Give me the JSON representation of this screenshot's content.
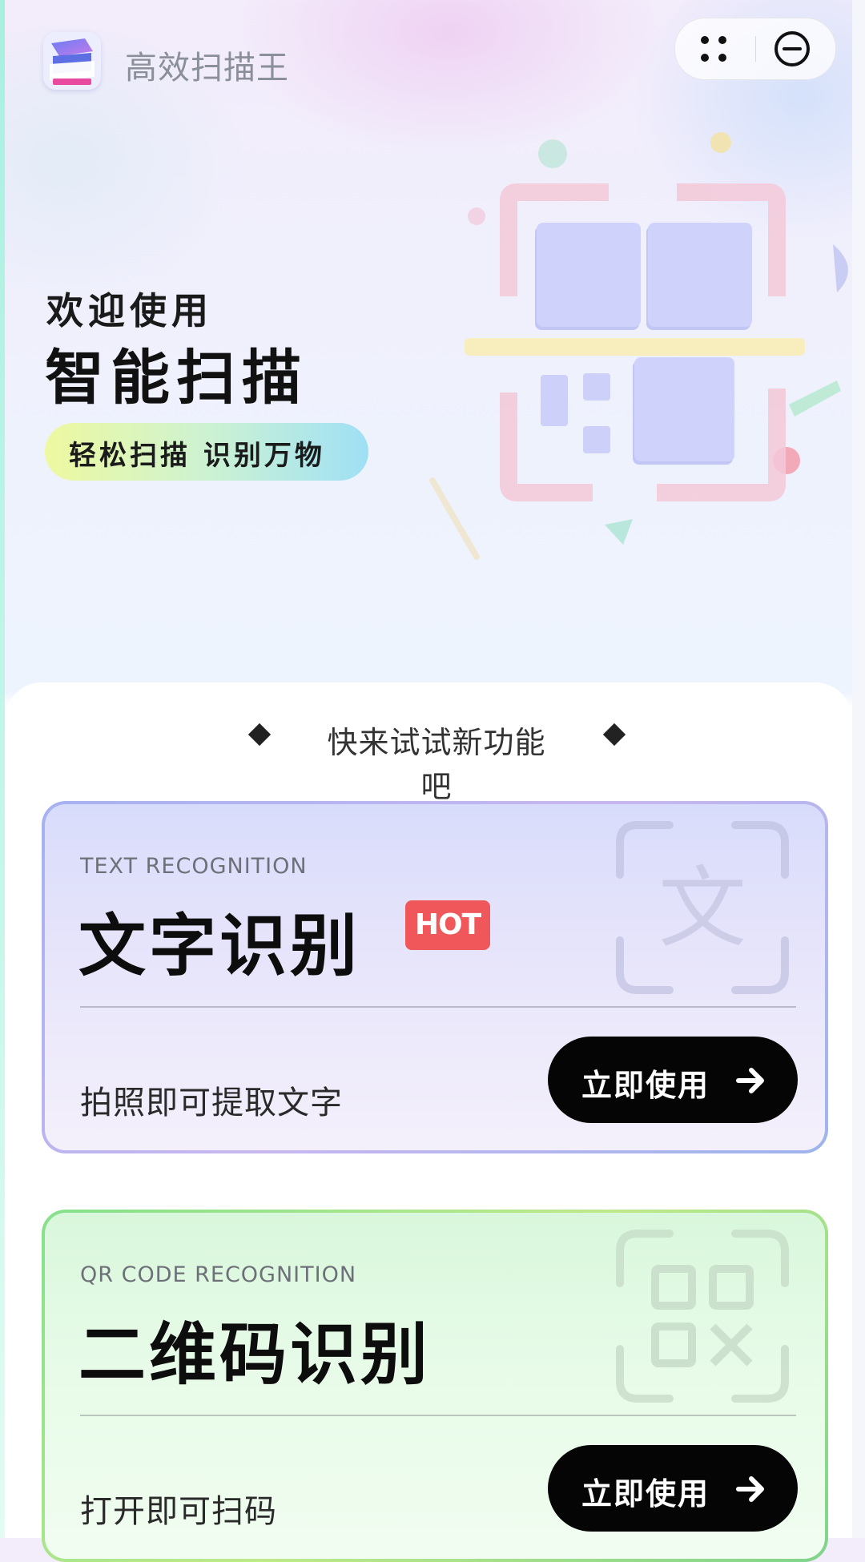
{
  "app": {
    "title": "高效扫描王",
    "logo_icon": "stacked-papers-icon"
  },
  "capsule": {
    "menu_icon": "more-dots-icon",
    "close_icon": "minus-circle-icon"
  },
  "hero": {
    "welcome": "欢迎使用",
    "title": "智能扫描",
    "tagline": "轻松扫描 识别万物",
    "illustration": "qr-scan-illustration"
  },
  "section": {
    "title": "快来试试新功能吧"
  },
  "cards": [
    {
      "subtitle": "TEXT RECOGNITION",
      "title": "文字识别",
      "badge": "HOT",
      "description": "拍照即可提取文字",
      "button_label": "立即使用",
      "watermark_icon": "text-scan-icon",
      "watermark_glyph": "文"
    },
    {
      "subtitle": "QR CODE RECOGNITION",
      "title": "二维码识别",
      "description": "打开即可扫码",
      "button_label": "立即使用",
      "watermark_icon": "qr-scan-icon"
    }
  ],
  "colors": {
    "hot_badge": "#f0575a",
    "button_bg": "#050505",
    "text_card_border": "#a6b2f0",
    "qr_card_border": "#86e08d"
  }
}
